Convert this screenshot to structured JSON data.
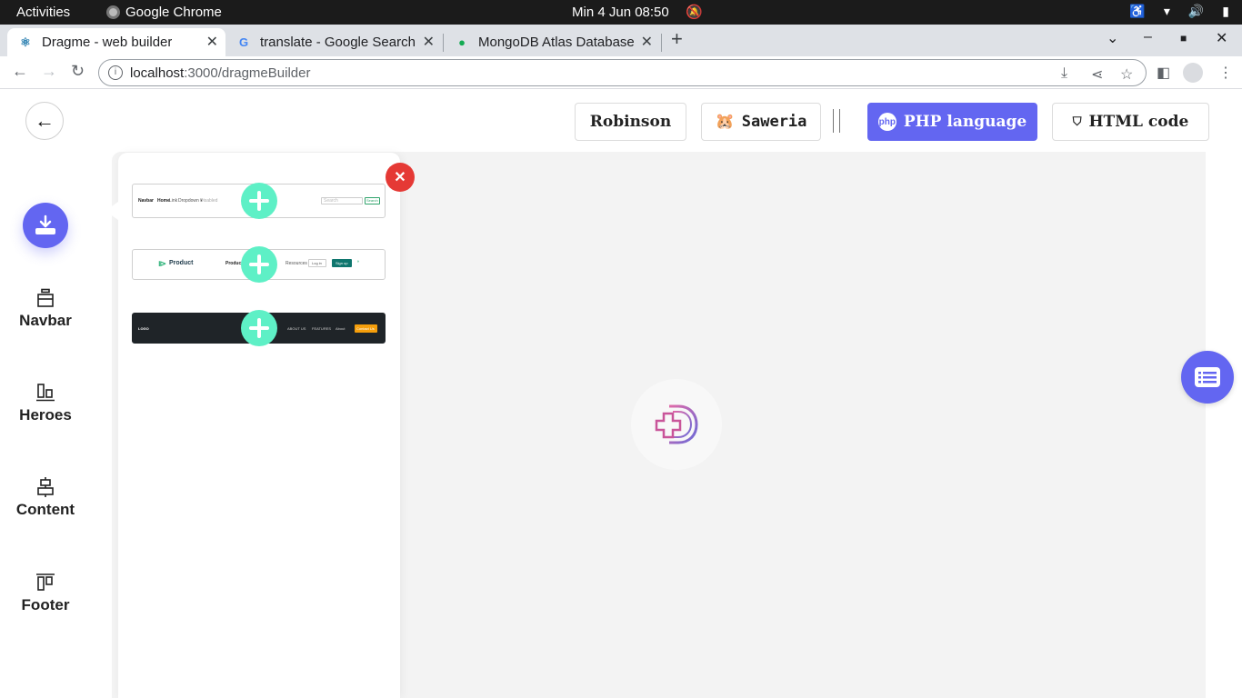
{
  "system_bar": {
    "activities": "Activities",
    "app_name": "Google Chrome",
    "clock": "Min  4 Jun  08:50"
  },
  "browser": {
    "tabs": [
      {
        "title": "Dragme - web builder",
        "active": true
      },
      {
        "title": "translate - Google Search",
        "active": false
      },
      {
        "title": "MongoDB Atlas Database",
        "active": false
      }
    ],
    "url_host": "localhost",
    "url_path": ":3000/dragmeBuilder"
  },
  "header": {
    "robinson_label": "Robinson",
    "saweria_label": "Saweria",
    "php_label": "PHP language",
    "html_label": "HTML code"
  },
  "sidebar": {
    "items": [
      {
        "label": "Navbar",
        "icon": "navbar-icon"
      },
      {
        "label": "Heroes",
        "icon": "heroes-icon"
      },
      {
        "label": "Content",
        "icon": "content-icon"
      },
      {
        "label": "Footer",
        "icon": "footer-icon"
      }
    ]
  },
  "panel": {
    "templates": [
      {
        "style": "light",
        "brand": "Navbar",
        "links": [
          "Home",
          "Link",
          "Dropdown ▾",
          "Disabled"
        ],
        "search_placeholder": "Search",
        "search_button": "Search"
      },
      {
        "style": "light",
        "brand": "Product",
        "links": [
          "Product",
          "Resources"
        ],
        "login": "Log in",
        "signup": "Sign up"
      },
      {
        "style": "dark",
        "brand": "LOGO",
        "links": [
          "ABOUT US",
          "FEATURES",
          "About"
        ],
        "cta": "Contact Us"
      }
    ]
  },
  "colors": {
    "accent": "#6366f1",
    "add_button": "#5ef0c6",
    "close_button": "#e53935"
  }
}
